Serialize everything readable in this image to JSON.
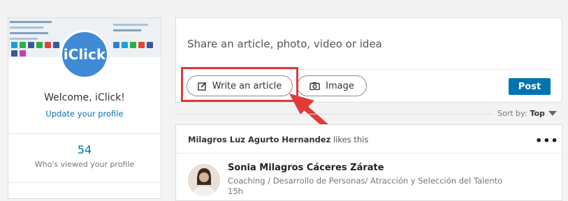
{
  "profile": {
    "avatar_text": "iClick",
    "welcome": "Welcome, iClick!",
    "update_link": "Update your profile",
    "views_count": "54",
    "views_label": "Who's viewed your profile"
  },
  "share": {
    "prompt": "Share an article, photo, video or idea",
    "write_article": "Write an article",
    "image": "Image",
    "post": "Post"
  },
  "sort": {
    "label": "Sort by:",
    "value": "Top"
  },
  "feed": {
    "activity_name": "Milagros Luz Agurto Hernandez",
    "activity_action": "likes this",
    "poster_name": "Sonia Milagros Cáceres Zárate",
    "poster_headline": "Coaching / Desarrollo de Personas/ Atracción y Selección del Talento",
    "poster_time": "15h"
  },
  "colors": {
    "accent": "#0073b1",
    "highlight": "#e03a3a",
    "avatar_bg": "#3f8ad4"
  }
}
